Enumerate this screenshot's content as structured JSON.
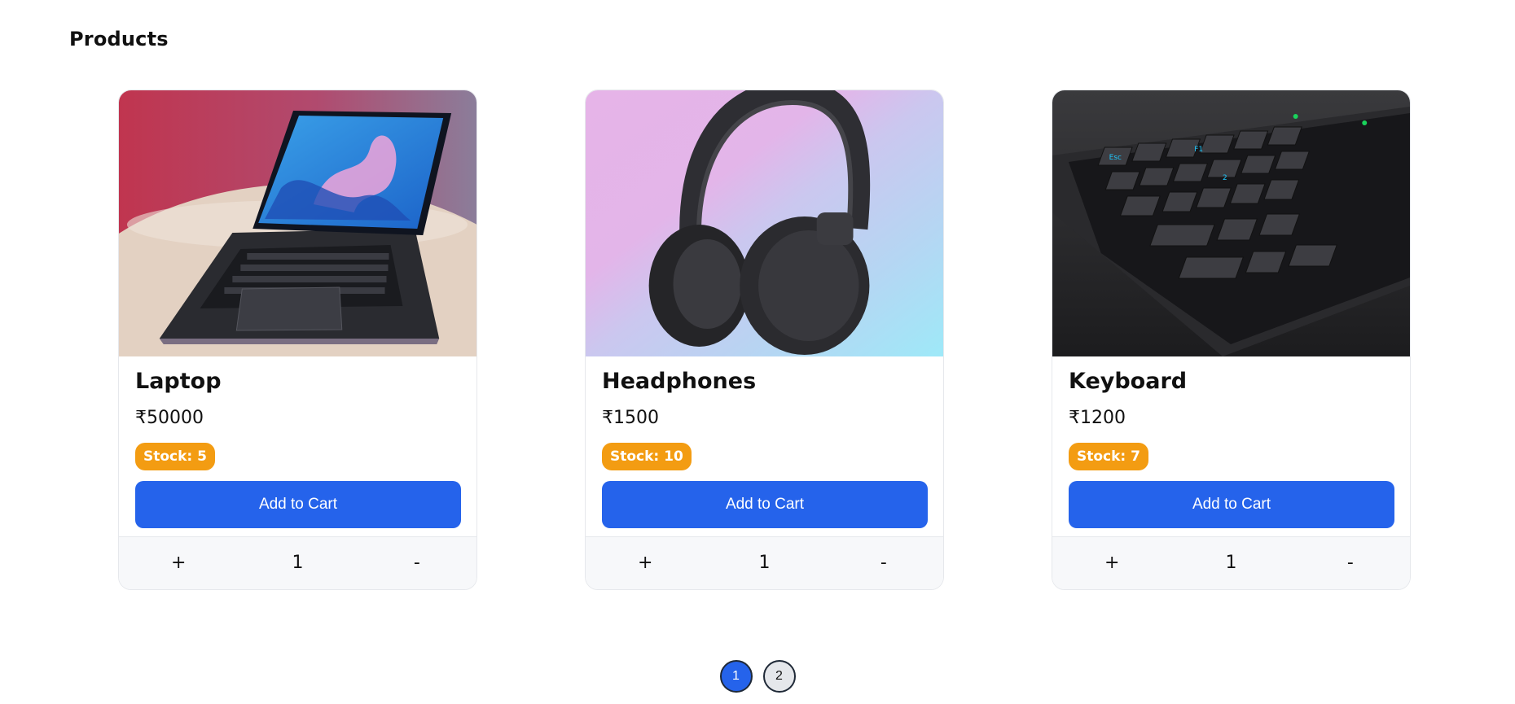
{
  "page": {
    "title": "Products"
  },
  "products": [
    {
      "name": "Laptop",
      "price": "₹50000",
      "stock": "Stock: 5",
      "add_label": "Add to Cart",
      "plus": "+",
      "qty": "1",
      "minus": "-"
    },
    {
      "name": "Headphones",
      "price": "₹1500",
      "stock": "Stock: 10",
      "add_label": "Add to Cart",
      "plus": "+",
      "qty": "1",
      "minus": "-"
    },
    {
      "name": "Keyboard",
      "price": "₹1200",
      "stock": "Stock: 7",
      "add_label": "Add to Cart",
      "plus": "+",
      "qty": "1",
      "minus": "-"
    }
  ],
  "pagination": {
    "pages": [
      "1",
      "2"
    ],
    "current": "1"
  },
  "colors": {
    "accent": "#2563eb",
    "stock_badge": "#f39c12",
    "card_border": "#e6e8ec",
    "footer_bg": "#f7f8fa"
  },
  "icons": [
    "laptop-photo",
    "headphones-photo",
    "keyboard-photo"
  ]
}
